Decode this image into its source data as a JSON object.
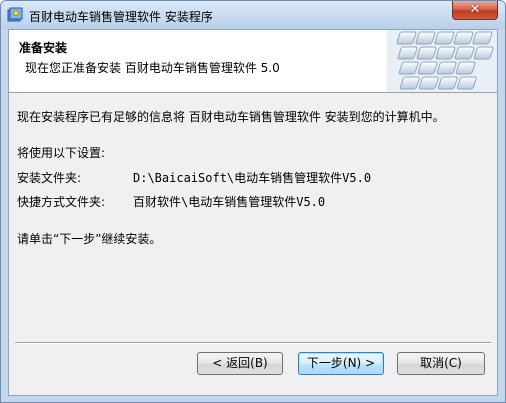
{
  "window": {
    "title": "百财电动车销售管理软件 安装程序",
    "close_label": "✕"
  },
  "header": {
    "title": "准备安装",
    "subtitle": "现在您正准备安装 百财电动车销售管理软件 5.0"
  },
  "body": {
    "intro": "现在安装程序已有足够的信息将 百财电动车销售管理软件 安装到您的计算机中。",
    "settings_heading": "将使用以下设置:",
    "install_folder_label": "安装文件夹:",
    "install_folder_value": "D:\\BaicaiSoft\\电动车销售管理软件V5.0",
    "shortcut_folder_label": "快捷方式文件夹:",
    "shortcut_folder_value": "百财软件\\电动车销售管理软件V5.0",
    "instruction": "请单击“下一步”继续安装。"
  },
  "buttons": {
    "back": "< 返回(B)",
    "next": "下一步(N) >",
    "cancel": "取消(C)"
  },
  "icons": {
    "app": "installer-app-icon",
    "header_art": "keyboard-keys-graphic"
  },
  "colors": {
    "titlebar": "#c9dcf1",
    "close_button": "#c23a1d",
    "default_button_border": "#3c7fb1"
  }
}
